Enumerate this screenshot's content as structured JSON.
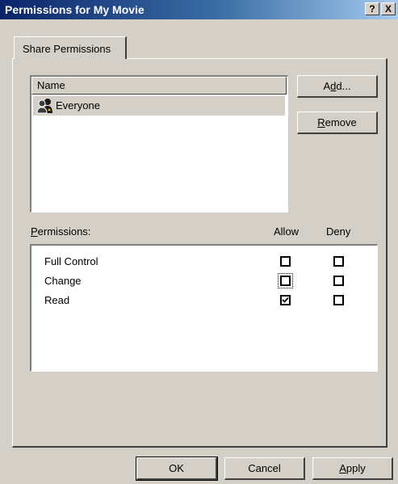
{
  "window": {
    "title": "Permissions for My Movie",
    "help_button": "?",
    "close_button": "X"
  },
  "tabs": [
    {
      "label": "Share Permissions",
      "active": true
    }
  ],
  "users_list": {
    "column_header": "Name",
    "items": [
      {
        "name": "Everyone",
        "icon": "group-users-icon",
        "selected": true
      }
    ]
  },
  "buttons": {
    "add": {
      "pre": "A",
      "accel": "d",
      "post": "d..."
    },
    "remove": {
      "pre": "",
      "accel": "R",
      "post": "emove"
    },
    "ok": "OK",
    "cancel": "Cancel",
    "apply": {
      "pre": "",
      "accel": "A",
      "post": "pply"
    }
  },
  "permissions": {
    "label": {
      "pre": "",
      "accel": "P",
      "post": "ermissions:"
    },
    "allow_header": "Allow",
    "deny_header": "Deny",
    "rows": [
      {
        "name": "Full Control",
        "allow": false,
        "deny": false
      },
      {
        "name": "Change",
        "allow": false,
        "deny": false,
        "focused": true
      },
      {
        "name": "Read",
        "allow": true,
        "deny": false
      }
    ]
  }
}
